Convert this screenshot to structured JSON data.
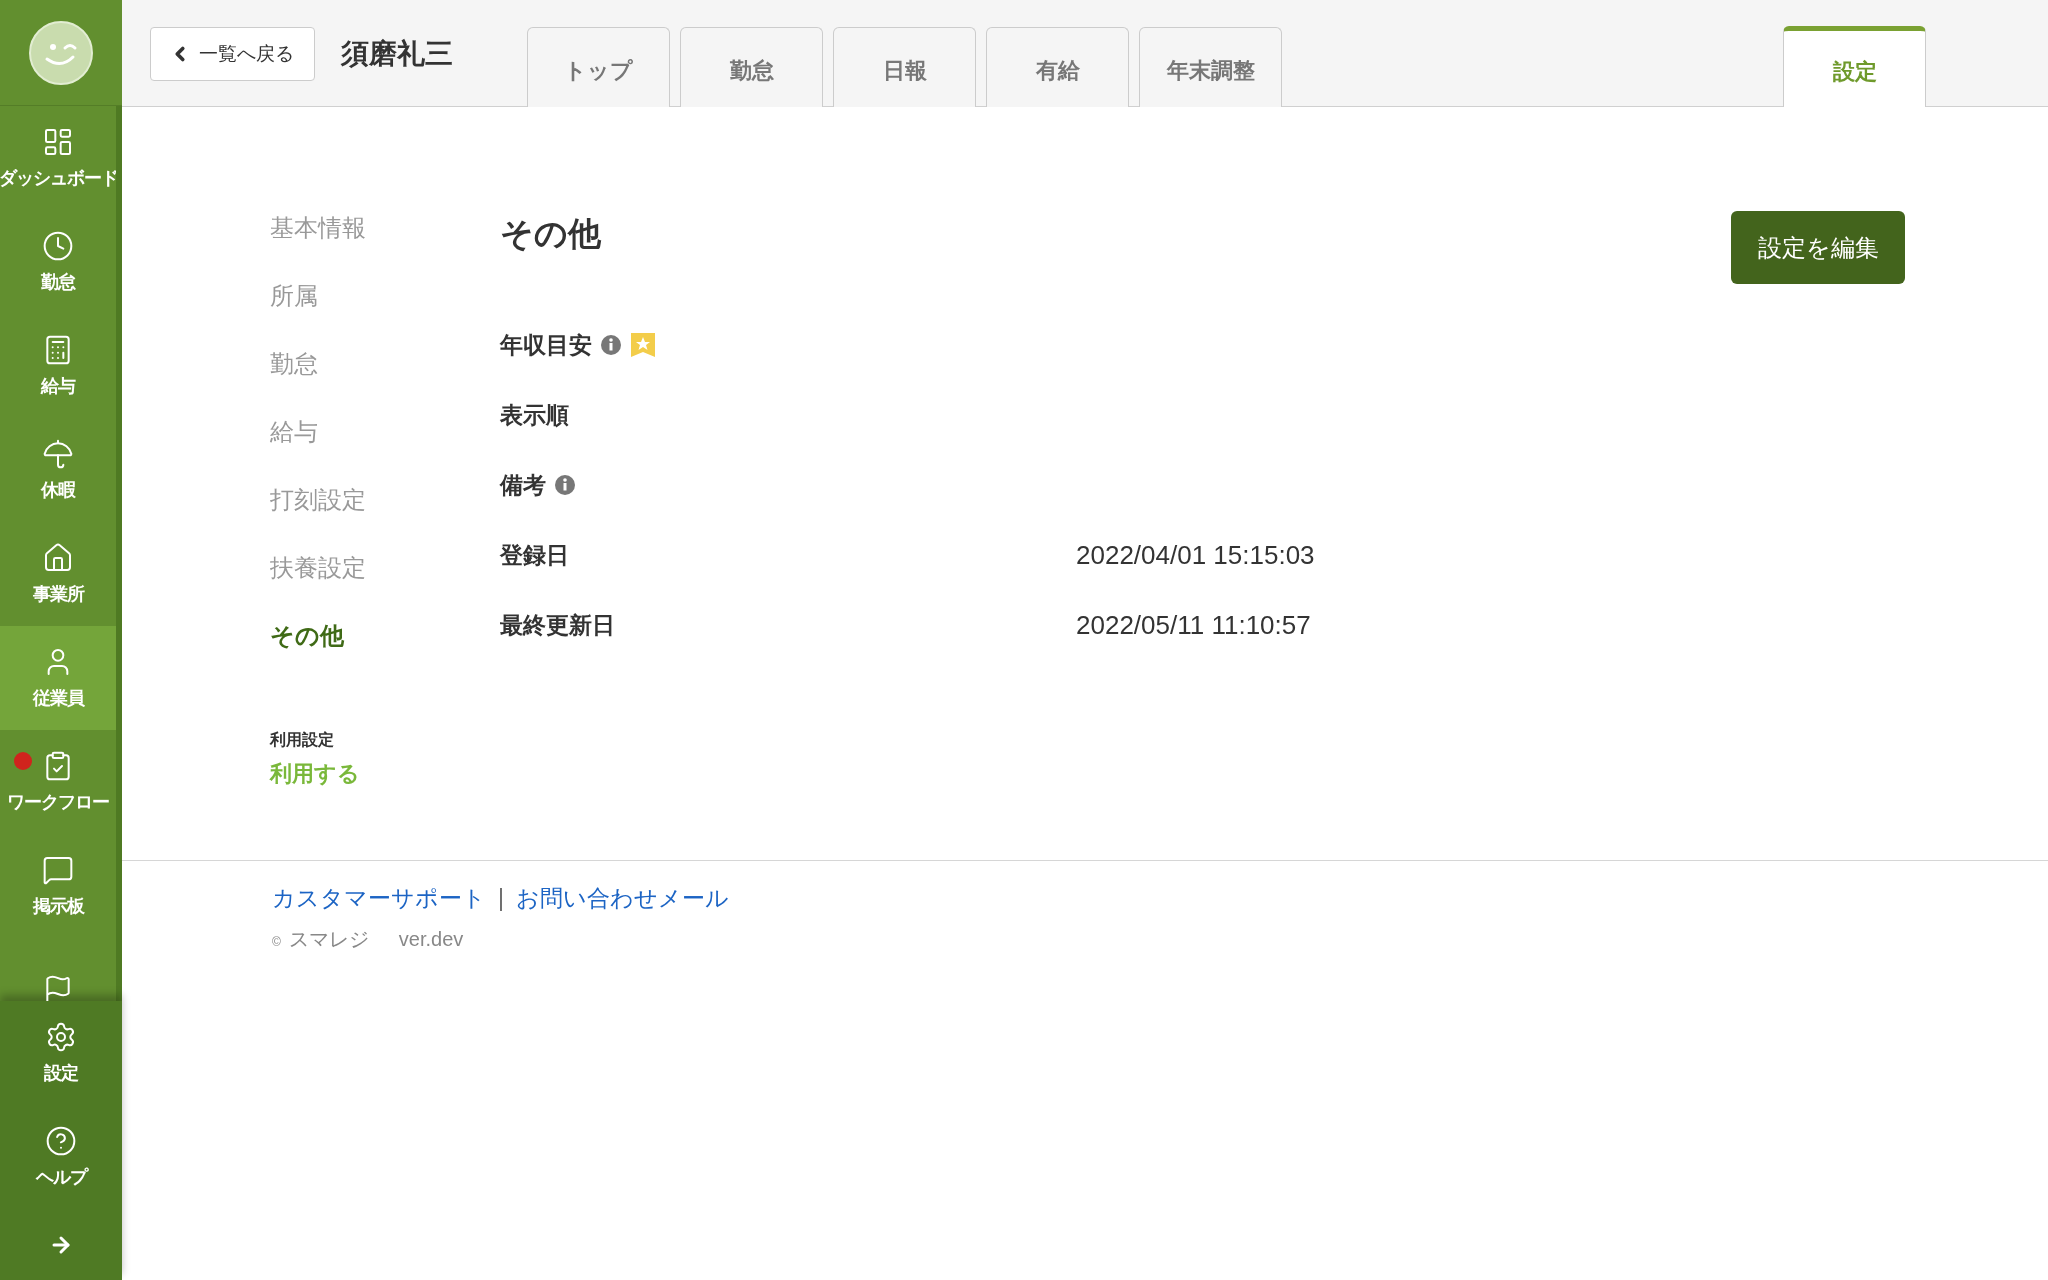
{
  "sidebar": {
    "items": [
      {
        "label": "ダッシュボード",
        "selected": false,
        "badge": false
      },
      {
        "label": "勤怠",
        "selected": false,
        "badge": false
      },
      {
        "label": "給与",
        "selected": false,
        "badge": false
      },
      {
        "label": "休暇",
        "selected": false,
        "badge": false
      },
      {
        "label": "事業所",
        "selected": false,
        "badge": false
      },
      {
        "label": "従業員",
        "selected": true,
        "badge": false
      },
      {
        "label": "ワークフロー",
        "selected": false,
        "badge": true
      },
      {
        "label": "掲示板",
        "selected": false,
        "badge": false
      },
      {
        "selected": false,
        "badge": false
      }
    ],
    "bottom_items": [
      {
        "label": "設定"
      },
      {
        "label": "ヘルプ"
      }
    ]
  },
  "header": {
    "back_button": "一覧へ戻る",
    "employee_name": "須磨礼三",
    "tabs": [
      {
        "label": "トップ",
        "selected": false
      },
      {
        "label": "勤怠",
        "selected": false
      },
      {
        "label": "日報",
        "selected": false
      },
      {
        "label": "有給",
        "selected": false
      },
      {
        "label": "年末調整",
        "selected": false
      }
    ],
    "right_tabs": [
      {
        "label": "設定",
        "selected": true
      }
    ]
  },
  "section_nav": {
    "items": [
      {
        "label": "基本情報",
        "selected": false
      },
      {
        "label": "所属",
        "selected": false
      },
      {
        "label": "勤怠",
        "selected": false
      },
      {
        "label": "給与",
        "selected": false
      },
      {
        "label": "打刻設定",
        "selected": false
      },
      {
        "label": "扶養設定",
        "selected": false
      },
      {
        "label": "その他",
        "selected": true
      }
    ],
    "usage_setting": {
      "label": "利用設定",
      "value": "利用する"
    }
  },
  "content": {
    "title": "その他",
    "edit_button": "設定を編集",
    "fields": [
      {
        "label": "年収目安",
        "info": true,
        "star": true
      },
      {
        "label": "表示順",
        "info": false,
        "star": false
      },
      {
        "label": "備考",
        "info": true,
        "star": false
      },
      {
        "label": "登録日",
        "value": "2022/04/01 15:15:03",
        "info": false,
        "star": false
      },
      {
        "label": "最終更新日",
        "value": "2022/05/11 11:10:57",
        "info": false,
        "star": false
      }
    ]
  },
  "footer": {
    "links": [
      "カスタマーサポート",
      "お問い合わせメール"
    ],
    "separator": "|",
    "copyright_mark": "©",
    "company": "スマレジ",
    "version": "ver.dev"
  }
}
